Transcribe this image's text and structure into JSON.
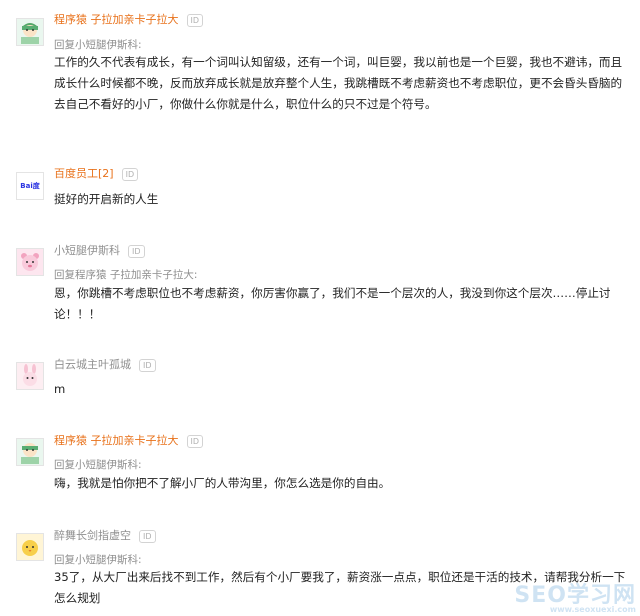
{
  "comments": [
    {
      "username": "程序猿 子拉加亲卡子拉大",
      "badge": "ID",
      "reply_to": "回复小短腿伊斯科:",
      "text": "工作的久不代表有成长，有一个词叫认知留级，还有一个词，叫巨婴，我以前也是一个巨婴，我也不避讳，而且成长什么时候都不晚，反而放弃成长就是放弃整个人生，我跳槽既不考虑薪资也不考虑职位，更不会昏头昏脑的去自己不看好的小厂，你做什么你就是什么，职位什么的只不过是个符号。",
      "avatar_icon": "green-cartoon-avatar-icon"
    },
    {
      "username": "百度员工[2]",
      "badge": "ID",
      "reply_to": "",
      "text": "挺好的开启新的人生",
      "avatar_icon": "baidu-logo-icon",
      "avatar_text": "Bai度"
    },
    {
      "username": "小短腿伊斯科",
      "badge": "ID",
      "reply_to": "回复程序猿 子拉加亲卡子拉大:",
      "text": "恩，你跳槽不考虑职位也不考虑薪资，你厉害你赢了，我们不是一个层次的人，我没到你这个层次……停止讨论！！！",
      "avatar_icon": "pink-bear-avatar-icon"
    },
    {
      "username": "白云城主叶孤城",
      "badge": "ID",
      "reply_to": "",
      "text": "m",
      "avatar_icon": "pink-rabbit-avatar-icon"
    },
    {
      "username": "程序猿 子拉加亲卡子拉大",
      "badge": "ID",
      "reply_to": "回复小短腿伊斯科:",
      "text": "嗨，我就是怕你把不了解小厂的人带沟里，你怎么选是你的自由。",
      "avatar_icon": "green-cartoon-avatar-icon"
    },
    {
      "username": "醉舞长剑指虚空",
      "badge": "ID",
      "reply_to": "回复小短腿伊斯科:",
      "text": "35了，从大厂出来后找不到工作，然后有个小厂要我了，薪资涨一点点，职位还是干活的技术，请帮我分析一下怎么规划",
      "avatar_icon": "yellow-chick-avatar-icon"
    }
  ],
  "watermark": {
    "main": "SEO学习网",
    "sub": "www.seoxuexi.com"
  }
}
